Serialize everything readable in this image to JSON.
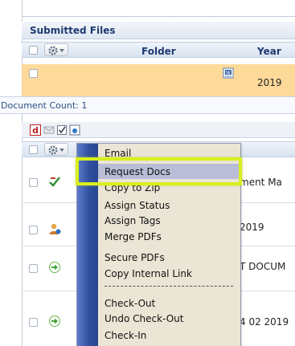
{
  "submitted_files": {
    "title": "Submitted Files",
    "columns": {
      "folder": "Folder",
      "year": "Year"
    },
    "row": {
      "year": "2019"
    },
    "document_count": "Document Count: 1"
  },
  "documents": {
    "rows": [
      {
        "text": "ment Ma"
      },
      {
        "text": "2019"
      },
      {
        "text": "T DOCUM"
      },
      {
        "text": "4 02 2019"
      }
    ]
  },
  "context_menu": {
    "items": [
      {
        "label": "Email"
      },
      {
        "label": "Request Docs"
      },
      {
        "label": "Copy to Zip"
      },
      {
        "label": "Assign Status"
      },
      {
        "label": "Assign Tags"
      },
      {
        "label": "Merge PDFs"
      },
      {
        "label": "Secure PDFs"
      },
      {
        "label": "Copy Internal Link"
      },
      {
        "label": "Check-Out"
      },
      {
        "label": "Undo Check-Out"
      },
      {
        "label": "Check-In"
      }
    ]
  },
  "colors": {
    "panel_title": "#1f3b70",
    "highlight_row": "#fdd99a",
    "menu_background": "#ebe5d5",
    "menu_hover": "#b9bed6",
    "annotation": "#d7ef1f"
  },
  "icons": [
    "gear-icon",
    "pdf-icon",
    "email-icon",
    "checklist-icon",
    "preview-icon",
    "word-doc-icon",
    "request-icon",
    "user-info-icon",
    "green-arrow-icon"
  ]
}
